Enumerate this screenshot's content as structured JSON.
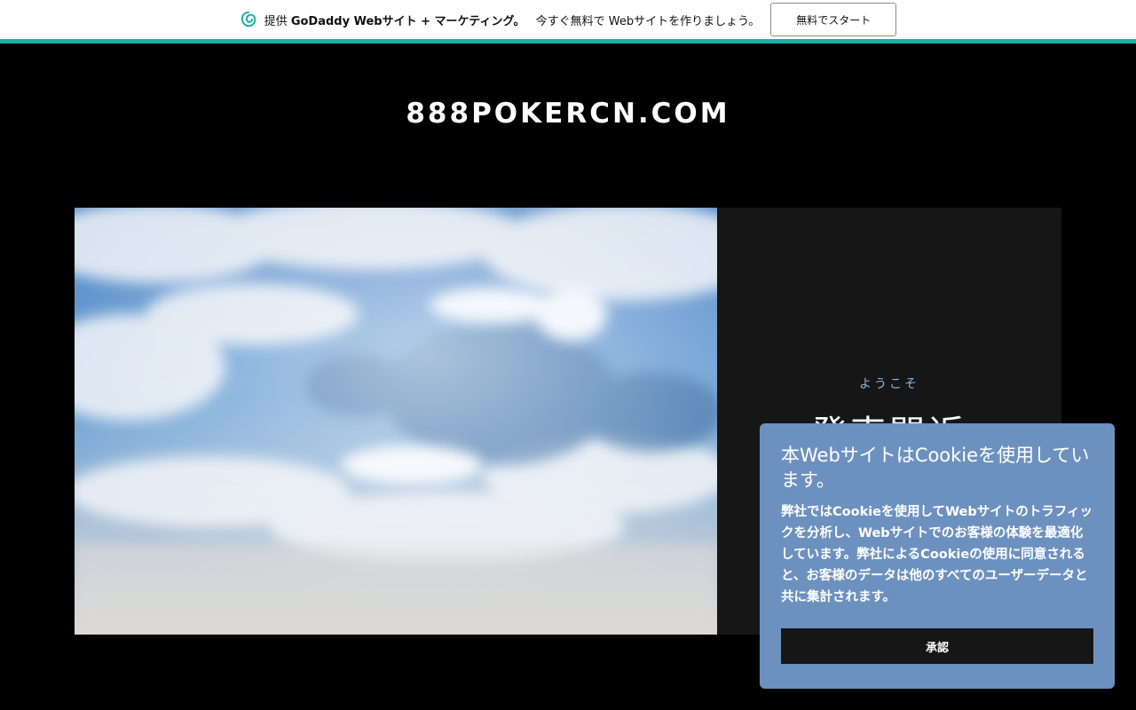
{
  "topbar": {
    "provided_by": "提供",
    "brand": "GoDaddy Webサイト + マーケティング。",
    "cta_text": "今すぐ無料で Webサイトを作りましょう。",
    "start_button": "無料でスタート",
    "accent_color": "#1bb0a6"
  },
  "site": {
    "title": "888POKERCN.COM"
  },
  "hero": {
    "welcome": "ようこそ",
    "heading": "発売間近",
    "image_icon": "sky-clouds-image"
  },
  "cookie": {
    "title": "本WebサイトはCookieを使用しています。",
    "body": "弊社ではCookieを使用してWebサイトのトラフィックを分析し、Webサイトでのお客様の体験を最適化しています。弊社によるCookieの使用に同意されると、お客様のデータは他のすべてのユーザーデータと共に集計されます。",
    "accept_button": "承認",
    "background_color": "#6d91bf"
  }
}
